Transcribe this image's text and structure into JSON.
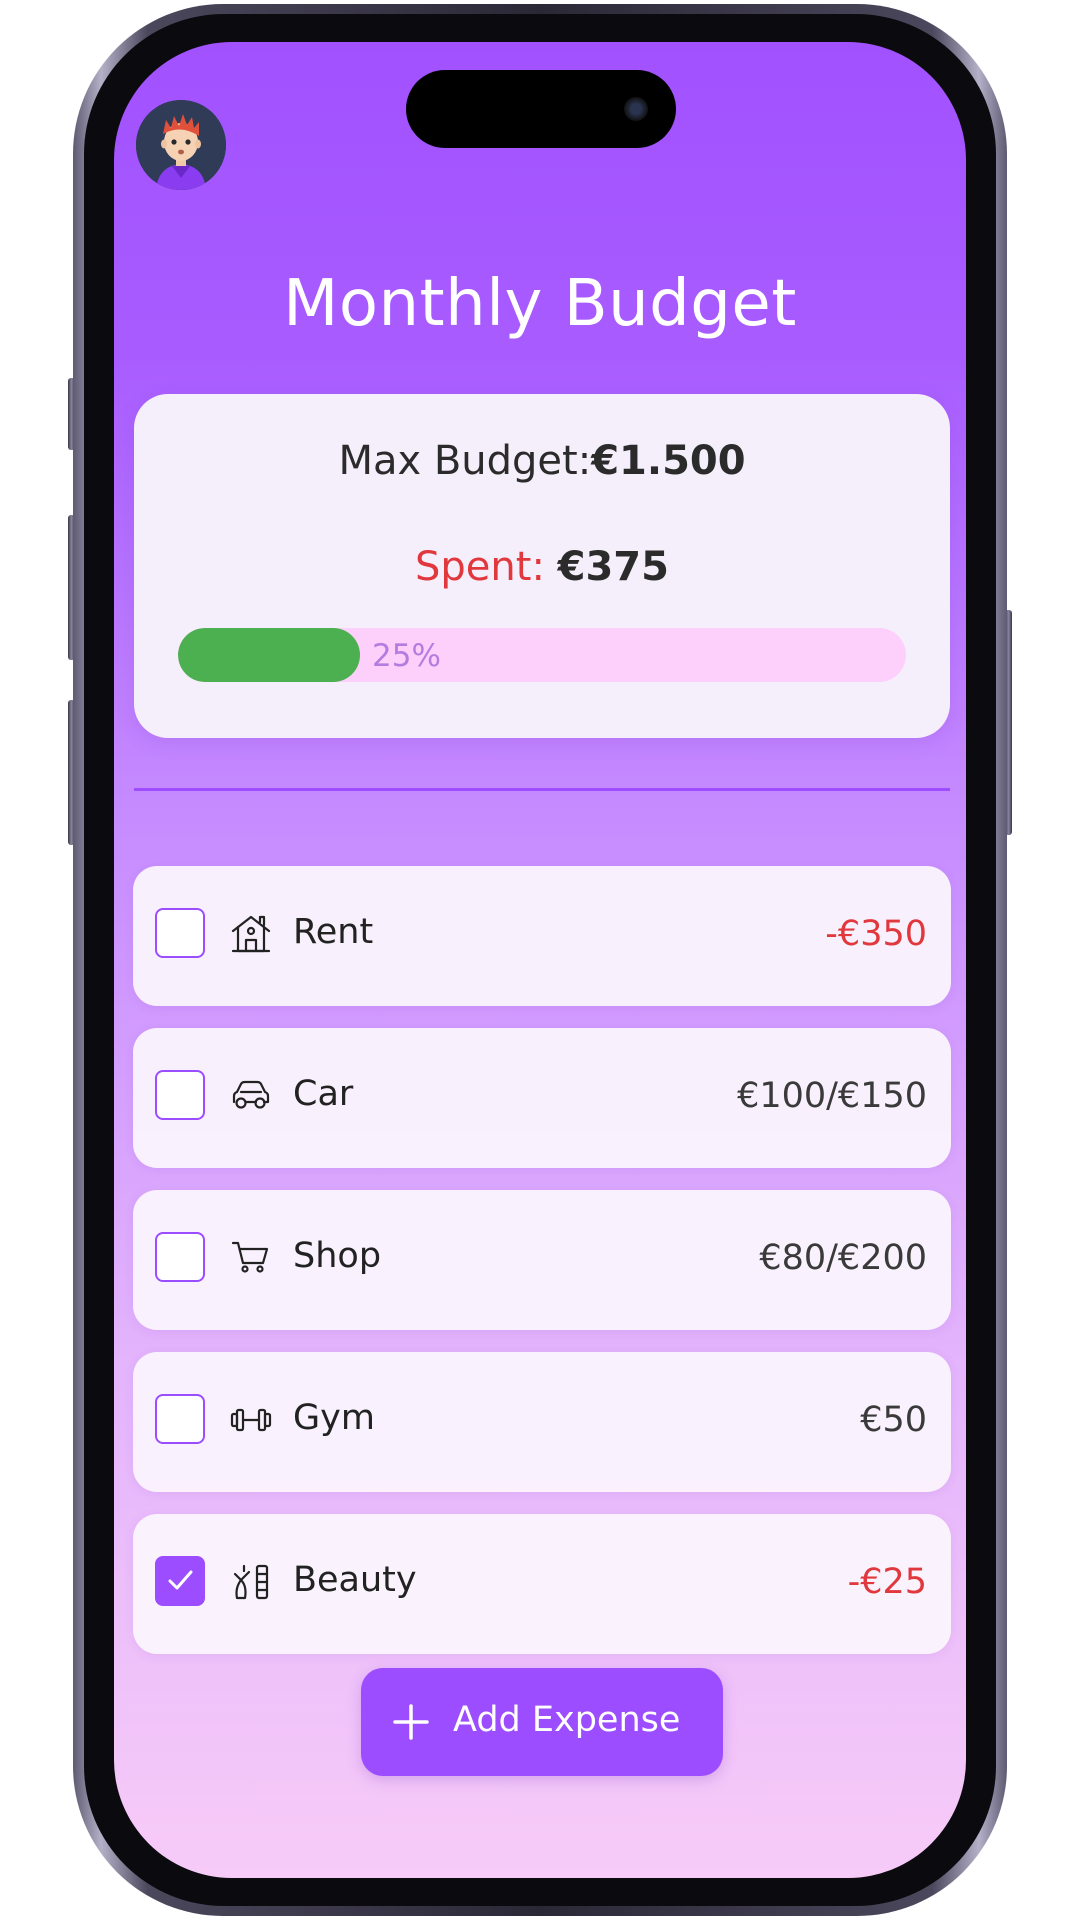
{
  "header": {
    "title": "Monthly Budget"
  },
  "summary": {
    "max_budget_label": "Max Budget:",
    "max_budget_value": "€1.500",
    "spent_label": "Spent:",
    "spent_value": "€375",
    "progress_percent_label": "25%",
    "progress_fraction": 0.25
  },
  "expenses": [
    {
      "label": "Rent",
      "amount": "-€350",
      "checked": true,
      "icon": "house-icon",
      "amount_color": "#e0383c"
    },
    {
      "label": "Car",
      "amount": "€100/€150",
      "checked": false,
      "icon": "car-icon",
      "amount_color": "#3a3a3a"
    },
    {
      "label": "Shop",
      "amount": "€80/€200",
      "checked": false,
      "icon": "cart-icon",
      "amount_color": "#3a3a3a"
    },
    {
      "label": "Gym",
      "amount": "€50",
      "checked": false,
      "icon": "dumbbell-icon",
      "amount_color": "#3a3a3a"
    },
    {
      "label": "Beauty",
      "amount": "-€25",
      "checked": true,
      "icon": "cosmetics-icon",
      "amount_color": "#e0383c"
    }
  ],
  "actions": {
    "add_expense_label": "Add Expense"
  },
  "colors": {
    "accent": "#9b4dff",
    "progress": "#4caf50",
    "progress_track": "#fdd0fb",
    "negative": "#e0383c"
  }
}
